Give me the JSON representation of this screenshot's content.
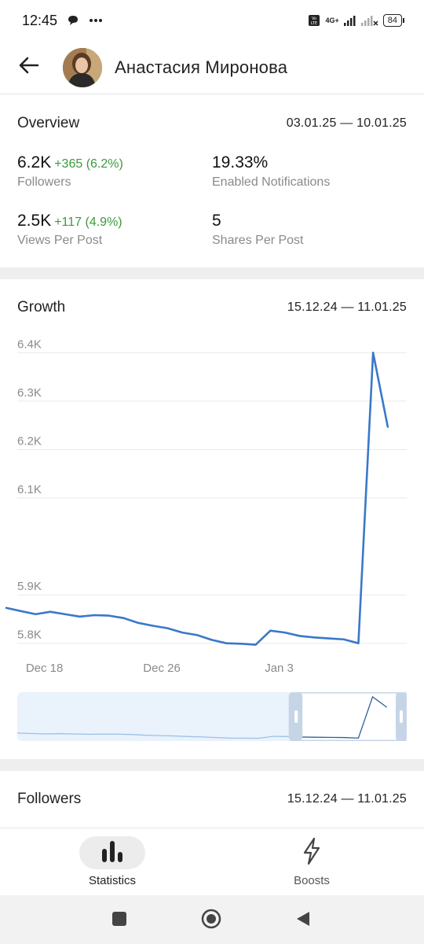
{
  "status_bar": {
    "time": "12:45",
    "battery": "84",
    "network": "4G+"
  },
  "header": {
    "name": "Анастасия Миронова"
  },
  "overview": {
    "title": "Overview",
    "range": "03.01.25 — 10.01.25",
    "stats": [
      {
        "value": "6.2K",
        "delta": "+365 (6.2%)",
        "label": "Followers"
      },
      {
        "value": "19.33%",
        "delta": "",
        "label": "Enabled Notifications"
      },
      {
        "value": "2.5K",
        "delta": "+117 (4.9%)",
        "label": "Views Per Post"
      },
      {
        "value": "5",
        "delta": "",
        "label": "Shares Per Post"
      }
    ]
  },
  "growth": {
    "title": "Growth",
    "range": "15.12.24 — 11.01.25"
  },
  "chart_data": {
    "type": "line",
    "ylim": [
      5780,
      6420
    ],
    "y_ticks": [
      "6.4K",
      "6.3K",
      "6.2K",
      "6.1K",
      "5.9K",
      "5.8K"
    ],
    "y_tick_values": [
      6400,
      6300,
      6200,
      6100,
      5900,
      5800
    ],
    "x_tick_labels": [
      "Dec 18",
      "Dec 26",
      "Jan 3"
    ],
    "x_tick_days": [
      3,
      11,
      19
    ],
    "x_range_days": [
      0.4,
      27.8
    ],
    "series_color": "#3a78c9",
    "points": [
      [
        0.4,
        5873
      ],
      [
        1.3,
        5867
      ],
      [
        2.4,
        5860
      ],
      [
        3.4,
        5865
      ],
      [
        4.4,
        5860
      ],
      [
        5.4,
        5855
      ],
      [
        6.4,
        5858
      ],
      [
        7.4,
        5857
      ],
      [
        8.4,
        5852
      ],
      [
        9.4,
        5842
      ],
      [
        10.4,
        5836
      ],
      [
        11.4,
        5831
      ],
      [
        12.4,
        5822
      ],
      [
        13.4,
        5817
      ],
      [
        14.4,
        5807
      ],
      [
        15.4,
        5800
      ],
      [
        16.4,
        5799
      ],
      [
        17.4,
        5797
      ],
      [
        18.4,
        5826
      ],
      [
        19.4,
        5822
      ],
      [
        20.4,
        5815
      ],
      [
        21.4,
        5812
      ],
      [
        22.4,
        5810
      ],
      [
        23.4,
        5808
      ],
      [
        24.4,
        5800
      ],
      [
        25.4,
        6400
      ],
      [
        26.4,
        6247
      ]
    ]
  },
  "navigator": {
    "window_start_fraction": 0.7
  },
  "followers": {
    "title": "Followers",
    "range": "15.12.24 — 11.01.25"
  },
  "bottom_nav": {
    "tabs": [
      {
        "label": "Statistics",
        "active": true
      },
      {
        "label": "Boosts",
        "active": false
      }
    ]
  },
  "colors": {
    "accent": "#3a78c9",
    "positive": "#3a9b3a",
    "muted": "#8a8a8a"
  }
}
